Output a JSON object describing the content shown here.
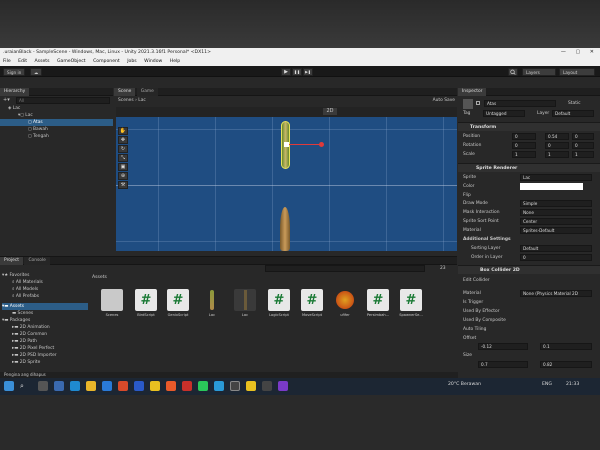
{
  "window": {
    "title": ".uraianBlack - SampleScene - Windows, Mac, Linux - Unity 2021.3.16f1 Personal* <DX11>",
    "controls": "—  ▢  ✕"
  },
  "menu": [
    "File",
    "Edit",
    "Assets",
    "GameObject",
    "Component",
    "Jobs",
    "Window",
    "Help"
  ],
  "toolbar": {
    "signin": "Sign in",
    "cloud": "☁",
    "play": "▶",
    "pause": "❚❚",
    "step": "▶❚",
    "layers": "Layers",
    "layout": "Layout"
  },
  "hierarchy": {
    "title": "Hierarchy",
    "search_placeholder": "All",
    "items": [
      {
        "label": "Lac"
      },
      {
        "label": "Lac"
      },
      {
        "label": "Atas"
      },
      {
        "label": "Bawah"
      },
      {
        "label": "Tengah"
      }
    ]
  },
  "scene": {
    "tab_scene": "Scene",
    "tab_game": "Game",
    "breadcrumb_scenes": "Scenes",
    "breadcrumb_obj": "Lac",
    "autosave": "Auto Save",
    "mode2d": "2D"
  },
  "inspector": {
    "title": "Inspector",
    "object_name": "Atas",
    "static": "Static",
    "tag_label": "Tag",
    "tag_value": "Untagged",
    "layer_label": "Layer",
    "layer_value": "Default",
    "transform": {
      "title": "Transform",
      "position": "Position",
      "rotation": "Rotation",
      "scale": "Scale",
      "pos": [
        "0",
        "0.54",
        "0"
      ],
      "rot": [
        "0",
        "0",
        "0"
      ],
      "scl": [
        "1",
        "1",
        "1"
      ]
    },
    "sprite_renderer": {
      "title": "Sprite Renderer",
      "sprite_label": "Sprite",
      "sprite_value": "Lac",
      "color_label": "Color",
      "flip_label": "Flip",
      "drawmode_label": "Draw Mode",
      "drawmode_value": "Simple",
      "mask_label": "Mask Interaction",
      "mask_value": "None",
      "sortpoint_label": "Sprite Sort Point",
      "sortpoint_value": "Center",
      "material_label": "Material",
      "material_value": "Sprites-Default",
      "additional": "Additional Settings",
      "sortlayer_label": "Sorting Layer",
      "sortlayer_value": "Default",
      "order_label": "Order in Layer",
      "order_value": "0"
    },
    "box_collider": {
      "title": "Box Collider 2D",
      "edit_label": "Edit Collider",
      "material_label": "Material",
      "material_value": "None (Physics Material 2D",
      "trigger_label": "Is Trigger",
      "effector_label": "Used By Effector",
      "composite_label": "Used By Composite",
      "autotiling_label": "Auto Tiling",
      "offset_label": "Offset",
      "offset_x": "-0.12",
      "offset_y": "0.1",
      "size_label": "Size",
      "size_x": "0.7",
      "size_y": "0.82"
    }
  },
  "project": {
    "tab_project": "Project",
    "tab_console": "Console",
    "favorites": "Favorites",
    "fav_items": [
      "All Materials",
      "All Models",
      "All Prefabs"
    ],
    "assets_root": "Assets",
    "asset_folders": [
      "Scenes"
    ],
    "packages": "Packages",
    "package_items": [
      "2D Animation",
      "2D Common",
      "2D Path",
      "2D Pixel Perfect",
      "2D PSD Importer",
      "2D Sprite"
    ],
    "breadcrumb": "Assets",
    "count": "23",
    "assets": [
      {
        "name": "Scenes"
      },
      {
        "name": "BirdScript"
      },
      {
        "name": "GenixScript"
      },
      {
        "name": "Lac"
      },
      {
        "name": "Lac"
      },
      {
        "name": "LogicScript"
      },
      {
        "name": "MoveScript"
      },
      {
        "name": "ufifer"
      },
      {
        "name": "Persimbah..."
      },
      {
        "name": "SpawnerSe..."
      }
    ]
  },
  "status": {
    "message": "Pengina ang dihapus"
  },
  "taskbar": {
    "weather": "20°C  Berawan",
    "lang": "ENG",
    "time": "21:33"
  }
}
